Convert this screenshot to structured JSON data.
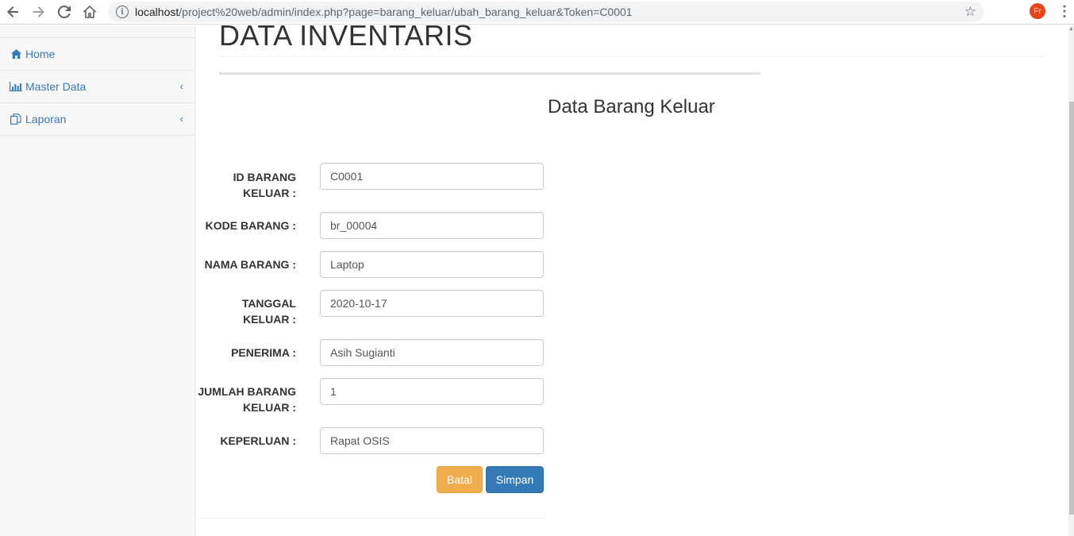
{
  "browser": {
    "url_host": "localhost",
    "url_path": "/project%20web/admin/index.php?page=barang_keluar/ubah_barang_keluar&Token=C0001",
    "profile_initials": "Fr"
  },
  "sidebar": {
    "items": [
      {
        "label": "Home",
        "icon": "home-icon",
        "has_submenu": false
      },
      {
        "label": "Master Data",
        "icon": "bar-chart-icon",
        "has_submenu": true
      },
      {
        "label": "Laporan",
        "icon": "copy-icon",
        "has_submenu": true
      }
    ]
  },
  "main": {
    "page_title": "DATA INVENTARIS",
    "form_title": "Data Barang Keluar",
    "fields": [
      {
        "label": "ID BARANG KELUAR :",
        "value": "C0001"
      },
      {
        "label": "KODE BARANG :",
        "value": "br_00004"
      },
      {
        "label": "NAMA BARANG :",
        "value": "Laptop"
      },
      {
        "label": "TANGGAL KELUAR :",
        "value": "2020-10-17"
      },
      {
        "label": "PENERIMA :",
        "value": "Asih Sugianti"
      },
      {
        "label": "JUMLAH BARANG KELUAR :",
        "value": "1"
      },
      {
        "label": "KEPERLUAN :",
        "value": "Rapat OSIS"
      }
    ],
    "batal_label": "Batal",
    "simpan_label": "Simpan"
  },
  "colors": {
    "link": "#337ab7",
    "warning": "#f0ad4e",
    "primary": "#337ab7",
    "sidebar_bg": "#f8f8f8"
  }
}
